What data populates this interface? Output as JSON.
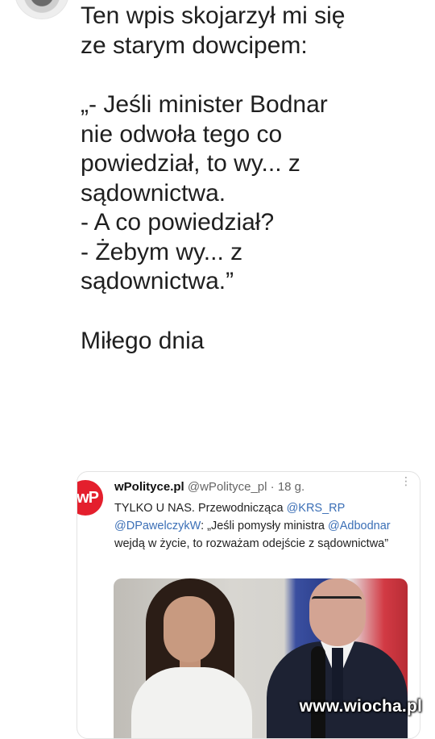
{
  "post": {
    "lines": [
      "Ten wpis skojarzył mi się",
      "ze starym dowcipem:",
      "",
      "„- Jeśli minister Bodnar",
      "nie odwoła tego co",
      "powiedział, to wy... z",
      "sądownictwa.",
      "- A co powiedział?",
      "- Żebym wy... z",
      "sądownictwa.”",
      "",
      "Miłego dnia"
    ]
  },
  "quoted_tweet": {
    "logo_text": "wP",
    "author_name": "wPolityce.pl",
    "author_handle": "@wPolityce_pl",
    "separator": "·",
    "time": "18 g.",
    "text_part1": "TYLKO U NAS. Przewodnicząca ",
    "mention1": "@KRS_RP",
    "mention2": "@DPawelczykW",
    "text_part2": ": „Jeśli pomysły ministra ",
    "mention3": "@Adbodnar",
    "text_part3": " wejdą w życie, to rozważam odejście z sądownictwa”"
  },
  "watermark": "www.wiocha.pl",
  "colors": {
    "link": "#3b6fb6",
    "logo_red": "#e41f2d"
  }
}
